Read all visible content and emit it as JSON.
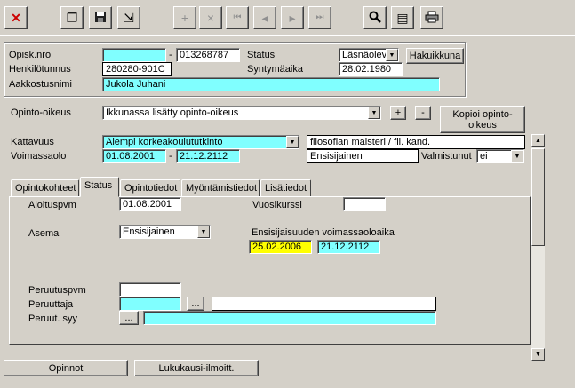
{
  "toolbar": {
    "buttons": [
      {
        "name": "close-button",
        "icon": "close-icon",
        "glyph": "✕"
      },
      {
        "name": "copy-button",
        "icon": "copy-icon",
        "glyph": "❐"
      },
      {
        "name": "save-button",
        "icon": "save-icon",
        "glyph": "💾"
      },
      {
        "name": "export-button",
        "icon": "arrow-icon",
        "glyph": "⇲"
      },
      {
        "name": "add-record-button",
        "icon": "add-record-icon",
        "glyph": "+"
      },
      {
        "name": "delete-record-button",
        "icon": "delete-record-icon",
        "glyph": "×"
      },
      {
        "name": "first-record-button",
        "icon": "first-record-icon",
        "glyph": "⏮"
      },
      {
        "name": "prev-record-button",
        "icon": "prev-record-icon",
        "glyph": "◂"
      },
      {
        "name": "next-record-button",
        "icon": "next-record-icon",
        "glyph": "▸"
      },
      {
        "name": "last-record-button",
        "icon": "last-record-icon",
        "glyph": "⏭"
      },
      {
        "name": "search-button",
        "icon": "search-icon",
        "glyph": "🔍"
      },
      {
        "name": "documents-button",
        "icon": "documents-icon",
        "glyph": "▤"
      },
      {
        "name": "print-button",
        "icon": "print-icon",
        "glyph": "⎙"
      }
    ]
  },
  "student": {
    "opisk_nro_label": "Opisk.nro",
    "opisk_nro_value": "",
    "opisk_nro_dash": "-",
    "opisk_nro_value2": "013268787",
    "status_label": "Status",
    "status_value": "Läsnäolev",
    "hakuikkuna_label": "Hakuikkuna",
    "henkilotunnus_label": "Henkilötunnus",
    "henkilotunnus_value": "280280-901C",
    "syntymaaika_label": "Syntymäaika",
    "syntymaaika_value": "28.02.1980",
    "aakkostusnimi_label": "Aakkostusnimi",
    "aakkostusnimi_value": "Jukola Juhani"
  },
  "study_right": {
    "opinto_oikeus_label": "Opinto-oikeus",
    "opinto_oikeus_value": "Ikkunassa lisätty opinto-oikeus",
    "plus_label": "+",
    "minus_label": "-",
    "kopioi_label": "Kopioi opinto-oikeus",
    "kattavuus_label": "Kattavuus",
    "kattavuus_value": "Alempi korkeakoulututkinto",
    "degree_value": "filosofian maisteri / fil. kand.",
    "voimassaolo_label": "Voimassaolo",
    "voimassaolo_start": "01.08.2001",
    "voimassaolo_dash": "-",
    "voimassaolo_end": "21.12.2112",
    "priority_value": "Ensisijainen",
    "valmistunut_label": "Valmistunut",
    "valmistunut_value": "ei"
  },
  "tabs": [
    {
      "label": "Opintokohteet",
      "active": false
    },
    {
      "label": "Status",
      "active": true
    },
    {
      "label": "Opintotiedot",
      "active": false
    },
    {
      "label": "Myöntämistiedot",
      "active": false
    },
    {
      "label": "Lisätiedot",
      "active": false
    }
  ],
  "status_tab": {
    "aloituspvm_label": "Aloituspvm",
    "aloituspvm_value": "01.08.2001",
    "vuosikurssi_label": "Vuosikurssi",
    "vuosikurssi_value": "",
    "asema_label": "Asema",
    "asema_value": "Ensisijainen",
    "validity_label": "Ensisijaisuuden voimassaoloaika",
    "validity_start": "25.02.2006",
    "validity_end": "21.12.2112",
    "peruutuspvm_label": "Peruutuspvm",
    "peruutuspvm_value": "",
    "peruuttaja_label": "Peruuttaja",
    "peruuttaja_value": "",
    "peruuttaja_name": "",
    "ellipsis_label": "...",
    "peruut_syy_label": "Peruut. syy",
    "peruut_syy_value": ""
  },
  "footer": {
    "opinnot_label": "Opinnot",
    "lukukausi_label": "Lukukausi-ilmoitt."
  },
  "colors": {
    "window_bg": "#d4d0c8",
    "cyan_field": "#80ffff",
    "yellow_field": "#ffff00",
    "close_red": "#cc0000"
  }
}
